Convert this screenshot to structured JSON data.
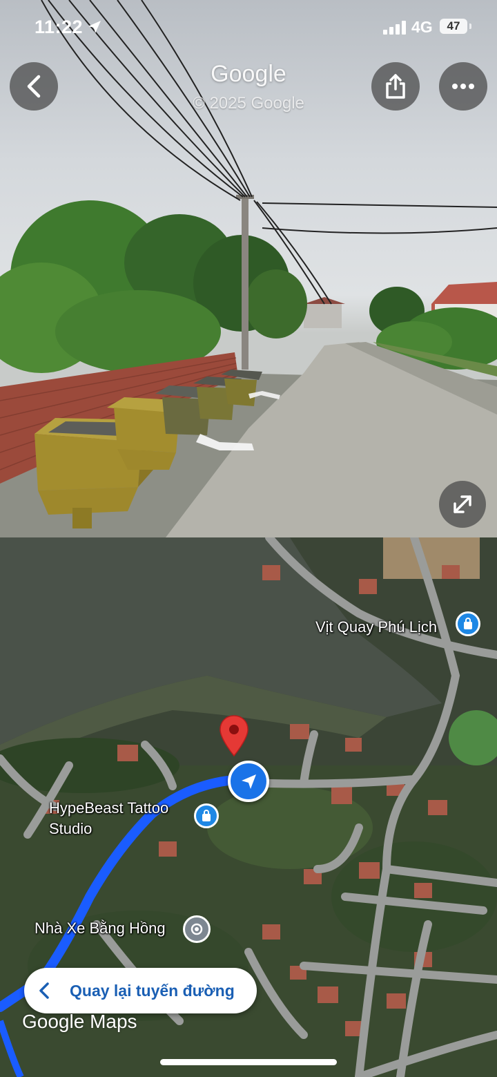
{
  "status_bar": {
    "time": "11:22",
    "network": "4G",
    "battery": "47"
  },
  "street_view": {
    "title": "Google",
    "copyright": "© 2025 Google"
  },
  "map": {
    "places": [
      {
        "name": "Vịt Quay Phú Lịch",
        "icon": "shopping-bag-icon"
      },
      {
        "name": "HypeBeast Tattoo Studio",
        "icon": "shopping-bag-icon"
      },
      {
        "name": "Nhà Xe Bằng Hồng",
        "icon": "pin-icon"
      }
    ],
    "return_button": "Quay lại tuyến đường",
    "logo": "Google Maps"
  },
  "colors": {
    "route": "#1a5cff",
    "nav_dot": "#1a73e8",
    "poi": "#1e88e5",
    "pin": "#e53935"
  }
}
